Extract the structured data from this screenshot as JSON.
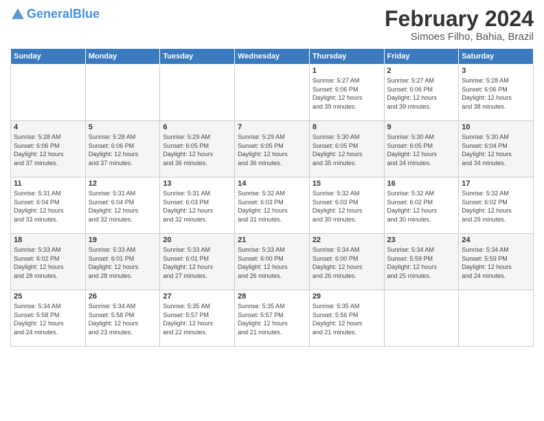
{
  "header": {
    "logo_general": "General",
    "logo_blue": "Blue",
    "title": "February 2024",
    "subtitle": "Simoes Filho, Bahia, Brazil"
  },
  "days_of_week": [
    "Sunday",
    "Monday",
    "Tuesday",
    "Wednesday",
    "Thursday",
    "Friday",
    "Saturday"
  ],
  "weeks": [
    [
      {
        "day": "",
        "info": ""
      },
      {
        "day": "",
        "info": ""
      },
      {
        "day": "",
        "info": ""
      },
      {
        "day": "",
        "info": ""
      },
      {
        "day": "1",
        "info": "Sunrise: 5:27 AM\nSunset: 6:06 PM\nDaylight: 12 hours\nand 39 minutes."
      },
      {
        "day": "2",
        "info": "Sunrise: 5:27 AM\nSunset: 6:06 PM\nDaylight: 12 hours\nand 39 minutes."
      },
      {
        "day": "3",
        "info": "Sunrise: 5:28 AM\nSunset: 6:06 PM\nDaylight: 12 hours\nand 38 minutes."
      }
    ],
    [
      {
        "day": "4",
        "info": "Sunrise: 5:28 AM\nSunset: 6:06 PM\nDaylight: 12 hours\nand 37 minutes."
      },
      {
        "day": "5",
        "info": "Sunrise: 5:28 AM\nSunset: 6:06 PM\nDaylight: 12 hours\nand 37 minutes."
      },
      {
        "day": "6",
        "info": "Sunrise: 5:29 AM\nSunset: 6:05 PM\nDaylight: 12 hours\nand 36 minutes."
      },
      {
        "day": "7",
        "info": "Sunrise: 5:29 AM\nSunset: 6:05 PM\nDaylight: 12 hours\nand 36 minutes."
      },
      {
        "day": "8",
        "info": "Sunrise: 5:30 AM\nSunset: 6:05 PM\nDaylight: 12 hours\nand 35 minutes."
      },
      {
        "day": "9",
        "info": "Sunrise: 5:30 AM\nSunset: 6:05 PM\nDaylight: 12 hours\nand 34 minutes."
      },
      {
        "day": "10",
        "info": "Sunrise: 5:30 AM\nSunset: 6:04 PM\nDaylight: 12 hours\nand 34 minutes."
      }
    ],
    [
      {
        "day": "11",
        "info": "Sunrise: 5:31 AM\nSunset: 6:04 PM\nDaylight: 12 hours\nand 33 minutes."
      },
      {
        "day": "12",
        "info": "Sunrise: 5:31 AM\nSunset: 6:04 PM\nDaylight: 12 hours\nand 32 minutes."
      },
      {
        "day": "13",
        "info": "Sunrise: 5:31 AM\nSunset: 6:03 PM\nDaylight: 12 hours\nand 32 minutes."
      },
      {
        "day": "14",
        "info": "Sunrise: 5:32 AM\nSunset: 6:03 PM\nDaylight: 12 hours\nand 31 minutes."
      },
      {
        "day": "15",
        "info": "Sunrise: 5:32 AM\nSunset: 6:03 PM\nDaylight: 12 hours\nand 30 minutes."
      },
      {
        "day": "16",
        "info": "Sunrise: 5:32 AM\nSunset: 6:02 PM\nDaylight: 12 hours\nand 30 minutes."
      },
      {
        "day": "17",
        "info": "Sunrise: 5:32 AM\nSunset: 6:02 PM\nDaylight: 12 hours\nand 29 minutes."
      }
    ],
    [
      {
        "day": "18",
        "info": "Sunrise: 5:33 AM\nSunset: 6:02 PM\nDaylight: 12 hours\nand 28 minutes."
      },
      {
        "day": "19",
        "info": "Sunrise: 5:33 AM\nSunset: 6:01 PM\nDaylight: 12 hours\nand 28 minutes."
      },
      {
        "day": "20",
        "info": "Sunrise: 5:33 AM\nSunset: 6:01 PM\nDaylight: 12 hours\nand 27 minutes."
      },
      {
        "day": "21",
        "info": "Sunrise: 5:33 AM\nSunset: 6:00 PM\nDaylight: 12 hours\nand 26 minutes."
      },
      {
        "day": "22",
        "info": "Sunrise: 5:34 AM\nSunset: 6:00 PM\nDaylight: 12 hours\nand 26 minutes."
      },
      {
        "day": "23",
        "info": "Sunrise: 5:34 AM\nSunset: 5:59 PM\nDaylight: 12 hours\nand 25 minutes."
      },
      {
        "day": "24",
        "info": "Sunrise: 5:34 AM\nSunset: 5:59 PM\nDaylight: 12 hours\nand 24 minutes."
      }
    ],
    [
      {
        "day": "25",
        "info": "Sunrise: 5:34 AM\nSunset: 5:58 PM\nDaylight: 12 hours\nand 24 minutes."
      },
      {
        "day": "26",
        "info": "Sunrise: 5:34 AM\nSunset: 5:58 PM\nDaylight: 12 hours\nand 23 minutes."
      },
      {
        "day": "27",
        "info": "Sunrise: 5:35 AM\nSunset: 5:57 PM\nDaylight: 12 hours\nand 22 minutes."
      },
      {
        "day": "28",
        "info": "Sunrise: 5:35 AM\nSunset: 5:57 PM\nDaylight: 12 hours\nand 21 minutes."
      },
      {
        "day": "29",
        "info": "Sunrise: 5:35 AM\nSunset: 5:56 PM\nDaylight: 12 hours\nand 21 minutes."
      },
      {
        "day": "",
        "info": ""
      },
      {
        "day": "",
        "info": ""
      }
    ]
  ]
}
